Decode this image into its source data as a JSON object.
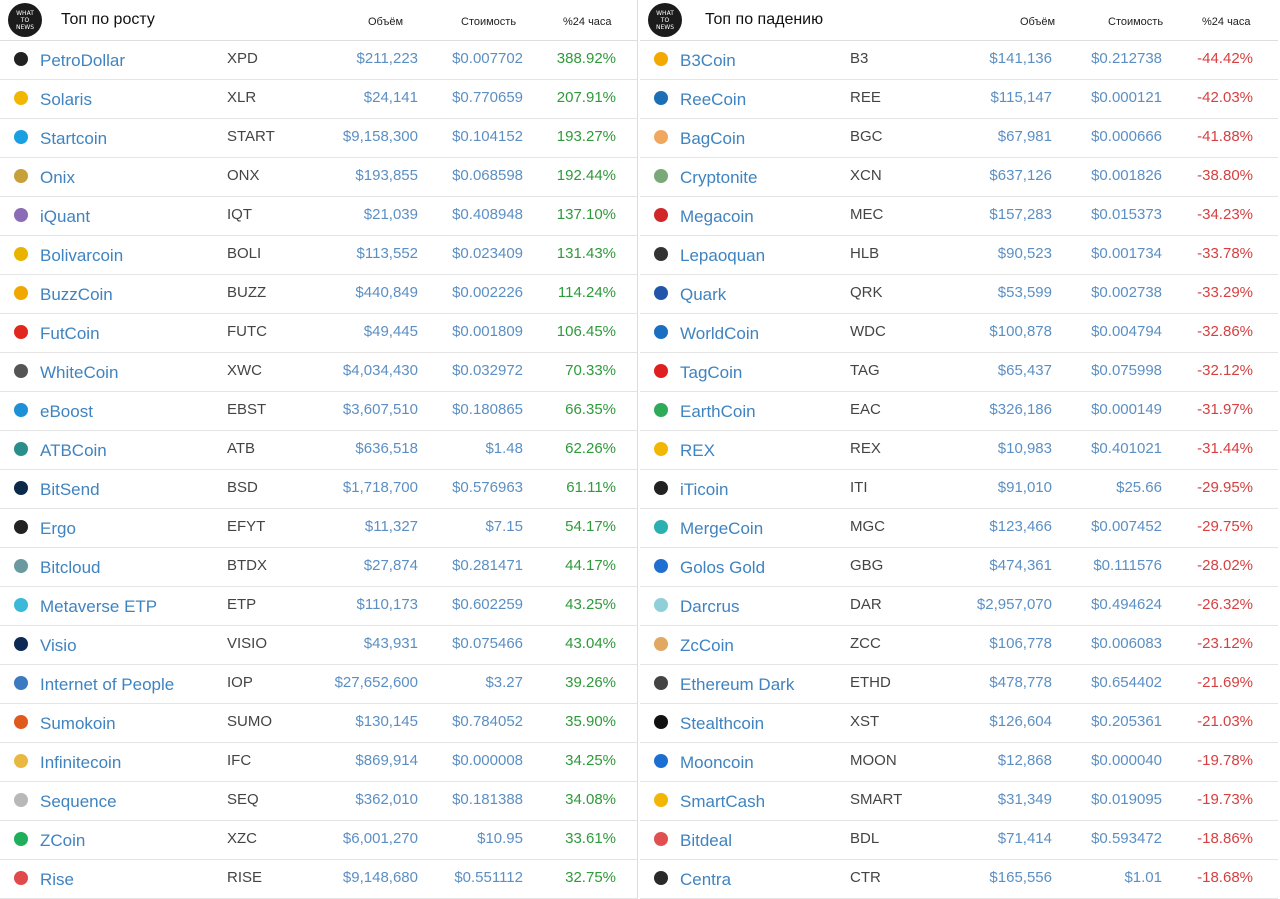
{
  "logo_text": "WHAT TO NEWS",
  "gainers": {
    "title": "Топ по росту",
    "columns": {
      "volume": "Объём",
      "price": "Стоимость",
      "change": "%24 часа"
    },
    "rows": [
      {
        "name": "PetroDollar",
        "symbol": "XPD",
        "volume": "$211,223",
        "price": "$0.007702",
        "change": "388.92%",
        "icon_color": "#222222",
        "icon": "phone-icon"
      },
      {
        "name": "Solaris",
        "symbol": "XLR",
        "volume": "$24,141",
        "price": "$0.770659",
        "change": "207.91%",
        "icon_color": "#f2b705",
        "icon": "solaris-icon"
      },
      {
        "name": "Startcoin",
        "symbol": "START",
        "volume": "$9,158,300",
        "price": "$0.104152",
        "change": "193.27%",
        "icon_color": "#1aa0e0",
        "icon": "startcoin-icon"
      },
      {
        "name": "Onix",
        "symbol": "ONX",
        "volume": "$193,855",
        "price": "$0.068598",
        "change": "192.44%",
        "icon_color": "#c8a03a",
        "icon": "onix-icon"
      },
      {
        "name": "iQuant",
        "symbol": "IQT",
        "volume": "$21,039",
        "price": "$0.408948",
        "change": "137.10%",
        "icon_color": "#8b6bb5",
        "icon": "iquant-icon"
      },
      {
        "name": "Bolivarcoin",
        "symbol": "BOLI",
        "volume": "$113,552",
        "price": "$0.023409",
        "change": "131.43%",
        "icon_color": "#e8b400",
        "icon": "bolivarcoin-icon"
      },
      {
        "name": "BuzzCoin",
        "symbol": "BUZZ",
        "volume": "$440,849",
        "price": "$0.002226",
        "change": "114.24%",
        "icon_color": "#f0a800",
        "icon": "buzzcoin-icon"
      },
      {
        "name": "FutCoin",
        "symbol": "FUTC",
        "volume": "$49,445",
        "price": "$0.001809",
        "change": "106.45%",
        "icon_color": "#e0281e",
        "icon": "futcoin-icon"
      },
      {
        "name": "WhiteCoin",
        "symbol": "XWC",
        "volume": "$4,034,430",
        "price": "$0.032972",
        "change": "70.33%",
        "icon_color": "#555555",
        "icon": "whitecoin-icon"
      },
      {
        "name": "eBoost",
        "symbol": "EBST",
        "volume": "$3,607,510",
        "price": "$0.180865",
        "change": "66.35%",
        "icon_color": "#1e90d6",
        "icon": "eboost-icon"
      },
      {
        "name": "ATBCoin",
        "symbol": "ATB",
        "volume": "$636,518",
        "price": "$1.48",
        "change": "62.26%",
        "icon_color": "#2a8f8a",
        "icon": "atbcoin-icon"
      },
      {
        "name": "BitSend",
        "symbol": "BSD",
        "volume": "$1,718,700",
        "price": "$0.576963",
        "change": "61.11%",
        "icon_color": "#0b2a4a",
        "icon": "bitsend-icon"
      },
      {
        "name": "Ergo",
        "symbol": "EFYT",
        "volume": "$11,327",
        "price": "$7.15",
        "change": "54.17%",
        "icon_color": "#222222",
        "icon": "ergo-icon"
      },
      {
        "name": "Bitcloud",
        "symbol": "BTDX",
        "volume": "$27,874",
        "price": "$0.281471",
        "change": "44.17%",
        "icon_color": "#6a9aa0",
        "icon": "bitcloud-icon"
      },
      {
        "name": "Metaverse ETP",
        "symbol": "ETP",
        "volume": "$110,173",
        "price": "$0.602259",
        "change": "43.25%",
        "icon_color": "#3cb8d8",
        "icon": "metaverse-icon"
      },
      {
        "name": "Visio",
        "symbol": "VISIO",
        "volume": "$43,931",
        "price": "$0.075466",
        "change": "43.04%",
        "icon_color": "#0d2a55",
        "icon": "visio-icon"
      },
      {
        "name": "Internet of People",
        "symbol": "IOP",
        "volume": "$27,652,600",
        "price": "$3.27",
        "change": "39.26%",
        "icon_color": "#3a7ac0",
        "icon": "iop-icon"
      },
      {
        "name": "Sumokoin",
        "symbol": "SUMO",
        "volume": "$130,145",
        "price": "$0.784052",
        "change": "35.90%",
        "icon_color": "#e05a1e",
        "icon": "sumokoin-icon"
      },
      {
        "name": "Infinitecoin",
        "symbol": "IFC",
        "volume": "$869,914",
        "price": "$0.000008",
        "change": "34.25%",
        "icon_color": "#e8b840",
        "icon": "infinitecoin-icon"
      },
      {
        "name": "Sequence",
        "symbol": "SEQ",
        "volume": "$362,010",
        "price": "$0.181388",
        "change": "34.08%",
        "icon_color": "#b8b8b8",
        "icon": "sequence-icon"
      },
      {
        "name": "ZCoin",
        "symbol": "XZC",
        "volume": "$6,001,270",
        "price": "$10.95",
        "change": "33.61%",
        "icon_color": "#1fae5a",
        "icon": "zcoin-icon"
      },
      {
        "name": "Rise",
        "symbol": "RISE",
        "volume": "$9,148,680",
        "price": "$0.551112",
        "change": "32.75%",
        "icon_color": "#e04a4a",
        "icon": "rise-icon"
      }
    ]
  },
  "losers": {
    "title": "Топ по падению",
    "columns": {
      "volume": "Объём",
      "price": "Стоимость",
      "change": "%24 часа"
    },
    "rows": [
      {
        "name": "B3Coin",
        "symbol": "B3",
        "volume": "$141,136",
        "price": "$0.212738",
        "change": "-44.42%",
        "icon_color": "#f2a900",
        "icon": "b3coin-icon"
      },
      {
        "name": "ReeCoin",
        "symbol": "REE",
        "volume": "$115,147",
        "price": "$0.000121",
        "change": "-42.03%",
        "icon_color": "#1c6fb5",
        "icon": "reecoin-icon"
      },
      {
        "name": "BagCoin",
        "symbol": "BGC",
        "volume": "$67,981",
        "price": "$0.000666",
        "change": "-41.88%",
        "icon_color": "#f0a860",
        "icon": "bagcoin-icon"
      },
      {
        "name": "Cryptonite",
        "symbol": "XCN",
        "volume": "$637,126",
        "price": "$0.001826",
        "change": "-38.80%",
        "icon_color": "#7aa878",
        "icon": "cryptonite-icon"
      },
      {
        "name": "Megacoin",
        "symbol": "MEC",
        "volume": "$157,283",
        "price": "$0.015373",
        "change": "-34.23%",
        "icon_color": "#d02828",
        "icon": "megacoin-icon"
      },
      {
        "name": "Lepaoquan",
        "symbol": "HLB",
        "volume": "$90,523",
        "price": "$0.001734",
        "change": "-33.78%",
        "icon_color": "#333333",
        "icon": "lepaoquan-icon"
      },
      {
        "name": "Quark",
        "symbol": "QRK",
        "volume": "$53,599",
        "price": "$0.002738",
        "change": "-33.29%",
        "icon_color": "#2255aa",
        "icon": "quark-icon"
      },
      {
        "name": "WorldCoin",
        "symbol": "WDC",
        "volume": "$100,878",
        "price": "$0.004794",
        "change": "-32.86%",
        "icon_color": "#1a6fc0",
        "icon": "worldcoin-icon"
      },
      {
        "name": "TagCoin",
        "symbol": "TAG",
        "volume": "$65,437",
        "price": "$0.075998",
        "change": "-32.12%",
        "icon_color": "#e02020",
        "icon": "tagcoin-icon"
      },
      {
        "name": "EarthCoin",
        "symbol": "EAC",
        "volume": "$326,186",
        "price": "$0.000149",
        "change": "-31.97%",
        "icon_color": "#2eaa5a",
        "icon": "earthcoin-icon"
      },
      {
        "name": "REX",
        "symbol": "REX",
        "volume": "$10,983",
        "price": "$0.401021",
        "change": "-31.44%",
        "icon_color": "#f2b705",
        "icon": "rex-icon"
      },
      {
        "name": "iTicoin",
        "symbol": "ITI",
        "volume": "$91,010",
        "price": "$25.66",
        "change": "-29.95%",
        "icon_color": "#222222",
        "icon": "iticoin-icon"
      },
      {
        "name": "MergeCoin",
        "symbol": "MGC",
        "volume": "$123,466",
        "price": "$0.007452",
        "change": "-29.75%",
        "icon_color": "#2ab0b0",
        "icon": "mergecoin-icon"
      },
      {
        "name": "Golos Gold",
        "symbol": "GBG",
        "volume": "$474,361",
        "price": "$0.111576",
        "change": "-28.02%",
        "icon_color": "#1f6fd0",
        "icon": "golos-gold-icon"
      },
      {
        "name": "Darcrus",
        "symbol": "DAR",
        "volume": "$2,957,070",
        "price": "$0.494624",
        "change": "-26.32%",
        "icon_color": "#8fd0d8",
        "icon": "darcrus-icon"
      },
      {
        "name": "ZcCoin",
        "symbol": "ZCC",
        "volume": "$106,778",
        "price": "$0.006083",
        "change": "-23.12%",
        "icon_color": "#e0a860",
        "icon": "zccoin-icon"
      },
      {
        "name": "Ethereum Dark",
        "symbol": "ETHD",
        "volume": "$478,778",
        "price": "$0.654402",
        "change": "-21.69%",
        "icon_color": "#444444",
        "icon": "ethereum-dark-icon"
      },
      {
        "name": "Stealthcoin",
        "symbol": "XST",
        "volume": "$126,604",
        "price": "$0.205361",
        "change": "-21.03%",
        "icon_color": "#111111",
        "icon": "stealthcoin-icon"
      },
      {
        "name": "Mooncoin",
        "symbol": "MOON",
        "volume": "$12,868",
        "price": "$0.000040",
        "change": "-19.78%",
        "icon_color": "#1a6fd0",
        "icon": "mooncoin-icon"
      },
      {
        "name": "SmartCash",
        "symbol": "SMART",
        "volume": "$31,349",
        "price": "$0.019095",
        "change": "-19.73%",
        "icon_color": "#f2b705",
        "icon": "smartcash-icon"
      },
      {
        "name": "Bitdeal",
        "symbol": "BDL",
        "volume": "$71,414",
        "price": "$0.593472",
        "change": "-18.86%",
        "icon_color": "#e05050",
        "icon": "bitdeal-icon"
      },
      {
        "name": "Centra",
        "symbol": "CTR",
        "volume": "$165,556",
        "price": "$1.01",
        "change": "-18.68%",
        "icon_color": "#2a2a2a",
        "icon": "centra-icon"
      }
    ]
  }
}
